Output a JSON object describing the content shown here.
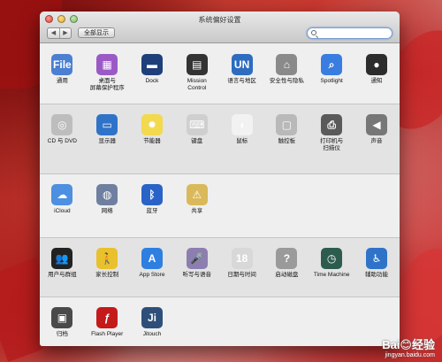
{
  "window": {
    "title": "系统偏好设置",
    "show_all": "全部显示",
    "back": "◀",
    "forward": "▶",
    "search_value": ""
  },
  "rows": [
    {
      "items": [
        {
          "name": "general",
          "label": "通用",
          "icon": "general-icon",
          "color": "#4a7fd1",
          "glyph": "File"
        },
        {
          "name": "desktop-screensaver",
          "label": "桌面与\n屏幕保护程序",
          "icon": "desktop-icon",
          "color": "#9b59c6",
          "glyph": "▦"
        },
        {
          "name": "dock",
          "label": "Dock",
          "icon": "dock-icon",
          "color": "#1f3f7a",
          "glyph": "▬"
        },
        {
          "name": "mission-control",
          "label": "Mission\nControl",
          "icon": "mission-control-icon",
          "color": "#333333",
          "glyph": "▤"
        },
        {
          "name": "language-region",
          "label": "语言与地区",
          "icon": "flag-icon",
          "color": "#2d6cbf",
          "glyph": "UN"
        },
        {
          "name": "security-privacy",
          "label": "安全性与隐私",
          "icon": "house-icon",
          "color": "#8a8a8a",
          "glyph": "⌂"
        },
        {
          "name": "spotlight",
          "label": "Spotlight",
          "icon": "spotlight-icon",
          "color": "#3a7de0",
          "glyph": "⌕"
        },
        {
          "name": "notifications",
          "label": "通知",
          "icon": "notifications-icon",
          "color": "#2c2c2c",
          "glyph": "●"
        }
      ]
    },
    {
      "items": [
        {
          "name": "cd-dvd",
          "label": "CD 与 DVD",
          "icon": "disc-icon",
          "color": "#bdbdbd",
          "glyph": "◎"
        },
        {
          "name": "displays",
          "label": "显示器",
          "icon": "display-icon",
          "color": "#2f73c9",
          "glyph": "▭"
        },
        {
          "name": "energy-saver",
          "label": "节能器",
          "icon": "bulb-icon",
          "color": "#f2d94e",
          "glyph": "✹"
        },
        {
          "name": "keyboard",
          "label": "键盘",
          "icon": "keyboard-icon",
          "color": "#cfcfcf",
          "glyph": "⌨"
        },
        {
          "name": "mouse",
          "label": "鼠标",
          "icon": "mouse-icon",
          "color": "#f2f2f2",
          "glyph": "◖"
        },
        {
          "name": "trackpad",
          "label": "触控板",
          "icon": "trackpad-icon",
          "color": "#b9b9b9",
          "glyph": "▢"
        },
        {
          "name": "printers-scanners",
          "label": "打印机与\n扫描仪",
          "icon": "printer-icon",
          "color": "#5a5a5a",
          "glyph": "⎙"
        },
        {
          "name": "sound",
          "label": "声音",
          "icon": "speaker-icon",
          "color": "#777777",
          "glyph": "◀"
        }
      ]
    },
    {
      "items": [
        {
          "name": "icloud",
          "label": "iCloud",
          "icon": "cloud-icon",
          "color": "#4d8fe0",
          "glyph": "☁"
        },
        {
          "name": "network",
          "label": "网络",
          "icon": "globe-icon",
          "color": "#6f7fa0",
          "glyph": "◍"
        },
        {
          "name": "bluetooth",
          "label": "蓝牙",
          "icon": "bluetooth-icon",
          "color": "#2a63c8",
          "glyph": "ᛒ"
        },
        {
          "name": "sharing",
          "label": "共享",
          "icon": "folder-icon",
          "color": "#d9b95a",
          "glyph": "⚠"
        }
      ]
    },
    {
      "items": [
        {
          "name": "users-groups",
          "label": "用户与群组",
          "icon": "users-icon",
          "color": "#222222",
          "glyph": "👥"
        },
        {
          "name": "parental-controls",
          "label": "家长控制",
          "icon": "parental-icon",
          "color": "#e8c12c",
          "glyph": "🚶"
        },
        {
          "name": "app-store",
          "label": "App Store",
          "icon": "app-store-icon",
          "color": "#2f7fe0",
          "glyph": "A"
        },
        {
          "name": "dictation-speech",
          "label": "听写与语音",
          "icon": "microphone-icon",
          "color": "#8c7fb0",
          "glyph": "🎤"
        },
        {
          "name": "date-time",
          "label": "日期与时间",
          "icon": "clock-icon",
          "color": "#d8d8d8",
          "glyph": "18"
        },
        {
          "name": "startup-disk",
          "label": "启动磁盘",
          "icon": "disk-icon",
          "color": "#9a9a9a",
          "glyph": "?"
        },
        {
          "name": "time-machine",
          "label": "Time Machine",
          "icon": "time-machine-icon",
          "color": "#2d5c4f",
          "glyph": "◷"
        },
        {
          "name": "accessibility",
          "label": "辅助功能",
          "icon": "accessibility-icon",
          "color": "#2f73c9",
          "glyph": "♿"
        }
      ]
    },
    {
      "items": [
        {
          "name": "archive",
          "label": "归档",
          "icon": "archive-icon",
          "color": "#4a4a4a",
          "glyph": "▣"
        },
        {
          "name": "flash-player",
          "label": "Flash Player",
          "icon": "flash-icon",
          "color": "#c41a1a",
          "glyph": "ƒ"
        },
        {
          "name": "jitouch",
          "label": "Jitouch",
          "icon": "jitouch-icon",
          "color": "#2e4f7a",
          "glyph": "Ji"
        }
      ]
    }
  ],
  "watermark": {
    "text": "Bai😊经验",
    "url": "jingyan.baidu.com"
  }
}
